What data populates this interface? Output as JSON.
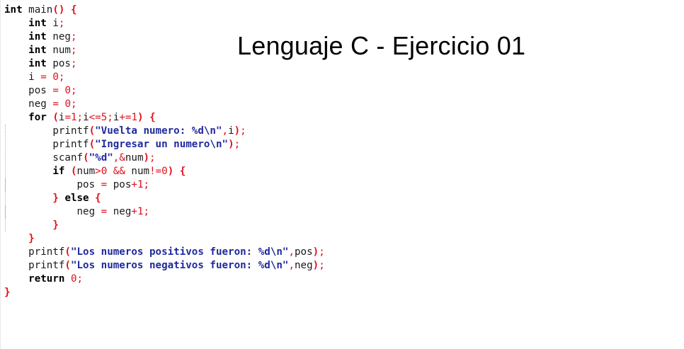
{
  "title": "Lenguaje C - Ejercicio 01",
  "code_lines": [
    {
      "indent": 0,
      "tokens": [
        [
          "kw",
          "int"
        ],
        [
          "id",
          " main"
        ],
        [
          "punc",
          "()"
        ],
        [
          "id",
          " "
        ],
        [
          "punc",
          "{"
        ]
      ]
    },
    {
      "indent": 1,
      "tokens": [
        [
          "kw",
          "int"
        ],
        [
          "id",
          " i"
        ],
        [
          "op",
          ";"
        ]
      ]
    },
    {
      "indent": 1,
      "tokens": [
        [
          "kw",
          "int"
        ],
        [
          "id",
          " neg"
        ],
        [
          "op",
          ";"
        ]
      ]
    },
    {
      "indent": 1,
      "tokens": [
        [
          "kw",
          "int"
        ],
        [
          "id",
          " num"
        ],
        [
          "op",
          ";"
        ]
      ]
    },
    {
      "indent": 1,
      "tokens": [
        [
          "kw",
          "int"
        ],
        [
          "id",
          " pos"
        ],
        [
          "op",
          ";"
        ]
      ]
    },
    {
      "indent": 1,
      "tokens": [
        [
          "id",
          "i "
        ],
        [
          "op",
          "="
        ],
        [
          "id",
          " "
        ],
        [
          "num",
          "0"
        ],
        [
          "op",
          ";"
        ]
      ]
    },
    {
      "indent": 1,
      "tokens": [
        [
          "id",
          "pos "
        ],
        [
          "op",
          "="
        ],
        [
          "id",
          " "
        ],
        [
          "num",
          "0"
        ],
        [
          "op",
          ";"
        ]
      ]
    },
    {
      "indent": 1,
      "tokens": [
        [
          "id",
          "neg "
        ],
        [
          "op",
          "="
        ],
        [
          "id",
          " "
        ],
        [
          "num",
          "0"
        ],
        [
          "op",
          ";"
        ]
      ]
    },
    {
      "indent": 1,
      "tokens": [
        [
          "kw",
          "for"
        ],
        [
          "id",
          " "
        ],
        [
          "punc",
          "("
        ],
        [
          "id",
          "i"
        ],
        [
          "op",
          "="
        ],
        [
          "num",
          "1"
        ],
        [
          "op",
          ";"
        ],
        [
          "id",
          "i"
        ],
        [
          "op",
          "<="
        ],
        [
          "num",
          "5"
        ],
        [
          "op",
          ";"
        ],
        [
          "id",
          "i"
        ],
        [
          "op",
          "+="
        ],
        [
          "num",
          "1"
        ],
        [
          "punc",
          ")"
        ],
        [
          "id",
          " "
        ],
        [
          "punc",
          "{"
        ]
      ]
    },
    {
      "indent": 2,
      "tokens": [
        [
          "id",
          "printf"
        ],
        [
          "punc",
          "("
        ],
        [
          "str",
          "\"Vuelta numero: %d\\n\""
        ],
        [
          "op",
          ","
        ],
        [
          "id",
          "i"
        ],
        [
          "punc",
          ")"
        ],
        [
          "op",
          ";"
        ]
      ]
    },
    {
      "indent": 2,
      "tokens": [
        [
          "id",
          "printf"
        ],
        [
          "punc",
          "("
        ],
        [
          "str",
          "\"Ingresar un numero\\n\""
        ],
        [
          "punc",
          ")"
        ],
        [
          "op",
          ";"
        ]
      ]
    },
    {
      "indent": 2,
      "tokens": [
        [
          "id",
          "scanf"
        ],
        [
          "punc",
          "("
        ],
        [
          "str",
          "\"%d\""
        ],
        [
          "op",
          ",&"
        ],
        [
          "id",
          "num"
        ],
        [
          "punc",
          ")"
        ],
        [
          "op",
          ";"
        ]
      ]
    },
    {
      "indent": 2,
      "tokens": [
        [
          "kw",
          "if"
        ],
        [
          "id",
          " "
        ],
        [
          "punc",
          "("
        ],
        [
          "id",
          "num"
        ],
        [
          "op",
          ">"
        ],
        [
          "num",
          "0"
        ],
        [
          "id",
          " "
        ],
        [
          "op",
          "&&"
        ],
        [
          "id",
          " num"
        ],
        [
          "op",
          "!="
        ],
        [
          "num",
          "0"
        ],
        [
          "punc",
          ")"
        ],
        [
          "id",
          " "
        ],
        [
          "punc",
          "{"
        ]
      ]
    },
    {
      "indent": 3,
      "tokens": [
        [
          "id",
          "pos "
        ],
        [
          "op",
          "="
        ],
        [
          "id",
          " pos"
        ],
        [
          "op",
          "+"
        ],
        [
          "num",
          "1"
        ],
        [
          "op",
          ";"
        ]
      ]
    },
    {
      "indent": 2,
      "tokens": [
        [
          "punc",
          "}"
        ],
        [
          "id",
          " "
        ],
        [
          "kw",
          "else"
        ],
        [
          "id",
          " "
        ],
        [
          "punc",
          "{"
        ]
      ]
    },
    {
      "indent": 3,
      "tokens": [
        [
          "id",
          "neg "
        ],
        [
          "op",
          "="
        ],
        [
          "id",
          " neg"
        ],
        [
          "op",
          "+"
        ],
        [
          "num",
          "1"
        ],
        [
          "op",
          ";"
        ]
      ]
    },
    {
      "indent": 2,
      "tokens": [
        [
          "punc",
          "}"
        ]
      ]
    },
    {
      "indent": 1,
      "tokens": [
        [
          "punc",
          "}"
        ]
      ]
    },
    {
      "indent": 1,
      "tokens": [
        [
          "id",
          "printf"
        ],
        [
          "punc",
          "("
        ],
        [
          "str",
          "\"Los numeros positivos fueron: %d\\n\""
        ],
        [
          "op",
          ","
        ],
        [
          "id",
          "pos"
        ],
        [
          "punc",
          ")"
        ],
        [
          "op",
          ";"
        ]
      ]
    },
    {
      "indent": 1,
      "tokens": [
        [
          "id",
          "printf"
        ],
        [
          "punc",
          "("
        ],
        [
          "str",
          "\"Los numeros negativos fueron: %d\\n\""
        ],
        [
          "op",
          ","
        ],
        [
          "id",
          "neg"
        ],
        [
          "punc",
          ")"
        ],
        [
          "op",
          ";"
        ]
      ]
    },
    {
      "indent": 1,
      "tokens": [
        [
          "kw",
          "return"
        ],
        [
          "id",
          " "
        ],
        [
          "num",
          "0"
        ],
        [
          "op",
          ";"
        ]
      ]
    },
    {
      "indent": 0,
      "tokens": [
        [
          "punc",
          "}"
        ]
      ]
    }
  ],
  "colors": {
    "keyword": "#000000",
    "string": "#1f2a9c",
    "operator": "#e0101c",
    "identifier": "#1a1a1a",
    "indent_guide": "#b5b5b5",
    "background": "#ffffff"
  }
}
